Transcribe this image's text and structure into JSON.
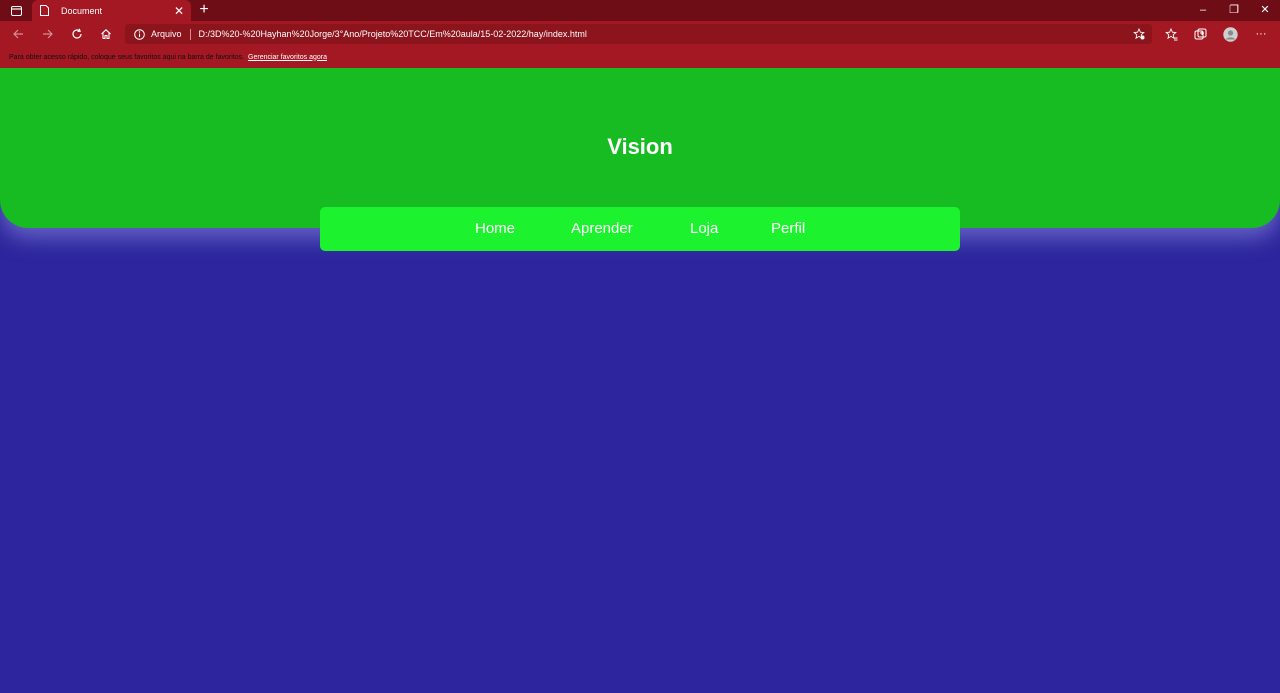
{
  "browser": {
    "tab": {
      "title": "Document",
      "icon": "page-icon"
    },
    "omnibox": {
      "site_label": "Arquivo",
      "url": "D:/3D%20-%20Hayhan%20Jorge/3°Ano/Projeto%20TCC/Em%20aula/15-02-2022/hay/index.html"
    },
    "favorites_bar": {
      "message": "Para obter acesso rápido, coloque seus favoritos aqui na barra de favoritos.",
      "link": "Gerenciar favoritos agora"
    },
    "window_controls": {
      "minimize": "–",
      "restore": "❐",
      "close": "✕"
    },
    "tab_close": "✕",
    "new_tab": "+",
    "more": "···"
  },
  "page": {
    "title": "Vision",
    "menu": [
      "Home",
      "Aprender",
      "Loja",
      "Perfil"
    ]
  },
  "colors": {
    "tabbar": "#6f0d16",
    "chrome": "#a31823",
    "header_green": "#16bc22",
    "menu_green": "#1df22f",
    "background_blue": "#2c259d"
  }
}
